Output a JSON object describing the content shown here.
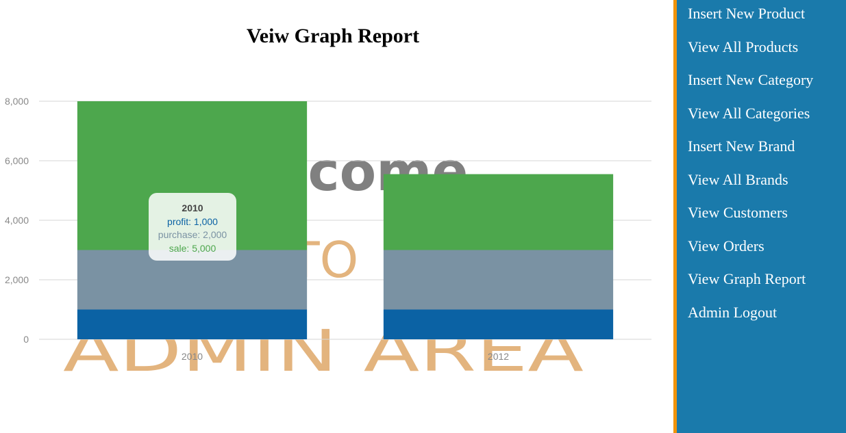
{
  "page": {
    "title": "Veiw Graph Report"
  },
  "watermark": {
    "line1": "Welcome",
    "line2": "TO",
    "line3": "ADMIN AREA",
    "colors": {
      "welcome": "#808080",
      "admin": "#e3b47e"
    }
  },
  "chart_data": {
    "type": "bar",
    "stacked": true,
    "categories": [
      "2010",
      "2012"
    ],
    "series": [
      {
        "name": "profit",
        "values": [
          1000,
          1000
        ],
        "color": "#0b62a4"
      },
      {
        "name": "purchase",
        "values": [
          2000,
          2000
        ],
        "color": "#7a92a3"
      },
      {
        "name": "sale",
        "values": [
          5000,
          2550
        ],
        "color": "#4da74d"
      }
    ],
    "y_ticks": [
      "0",
      "2,000",
      "4,000",
      "6,000",
      "8,000"
    ],
    "ylim": [
      0,
      8000
    ],
    "grid": true,
    "title": "",
    "xlabel": "",
    "ylabel": ""
  },
  "tooltip": {
    "title": "2010",
    "lines": [
      {
        "label": "profit: 1,000",
        "color": "#0b62a4"
      },
      {
        "label": "purchase: 2,000",
        "color": "#7a92a3"
      },
      {
        "label": "sale: 5,000",
        "color": "#4da74d"
      }
    ]
  },
  "sidebar": {
    "items": [
      {
        "label": "Insert New Product"
      },
      {
        "label": "View All Products"
      },
      {
        "label": "Insert New Category"
      },
      {
        "label": "View All Categories"
      },
      {
        "label": "Insert New Brand"
      },
      {
        "label": "View All Brands"
      },
      {
        "label": "View Customers"
      },
      {
        "label": "View Orders"
      },
      {
        "label": "View Graph Report"
      },
      {
        "label": "Admin Logout"
      }
    ],
    "colors": {
      "background": "#1a7aab",
      "border": "#f0930b"
    }
  }
}
